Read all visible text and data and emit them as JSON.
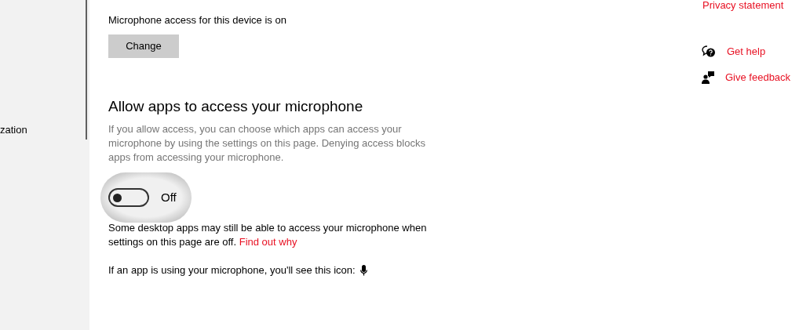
{
  "sidebar": {
    "items": [
      {
        "label": "zation"
      }
    ]
  },
  "device_access": {
    "status": "Microphone access for this device is on",
    "button": "Change"
  },
  "apps_access": {
    "heading": "Allow apps to access your microphone",
    "description": "If you allow access, you can choose which apps can access your microphone by using the settings on this page. Denying access blocks apps from accessing your microphone.",
    "toggle": {
      "on": false,
      "label": "Off"
    },
    "note": "Some desktop apps may still be able to access your microphone when settings on this page are off.",
    "note_link": "Find out why",
    "icon_note": "If an app is using your microphone, you'll see this icon:"
  },
  "side_links": {
    "privacy": "Privacy statement",
    "help": [
      {
        "kind": "help",
        "label": "Get help"
      },
      {
        "kind": "feedback",
        "label": "Give feedback"
      }
    ]
  }
}
